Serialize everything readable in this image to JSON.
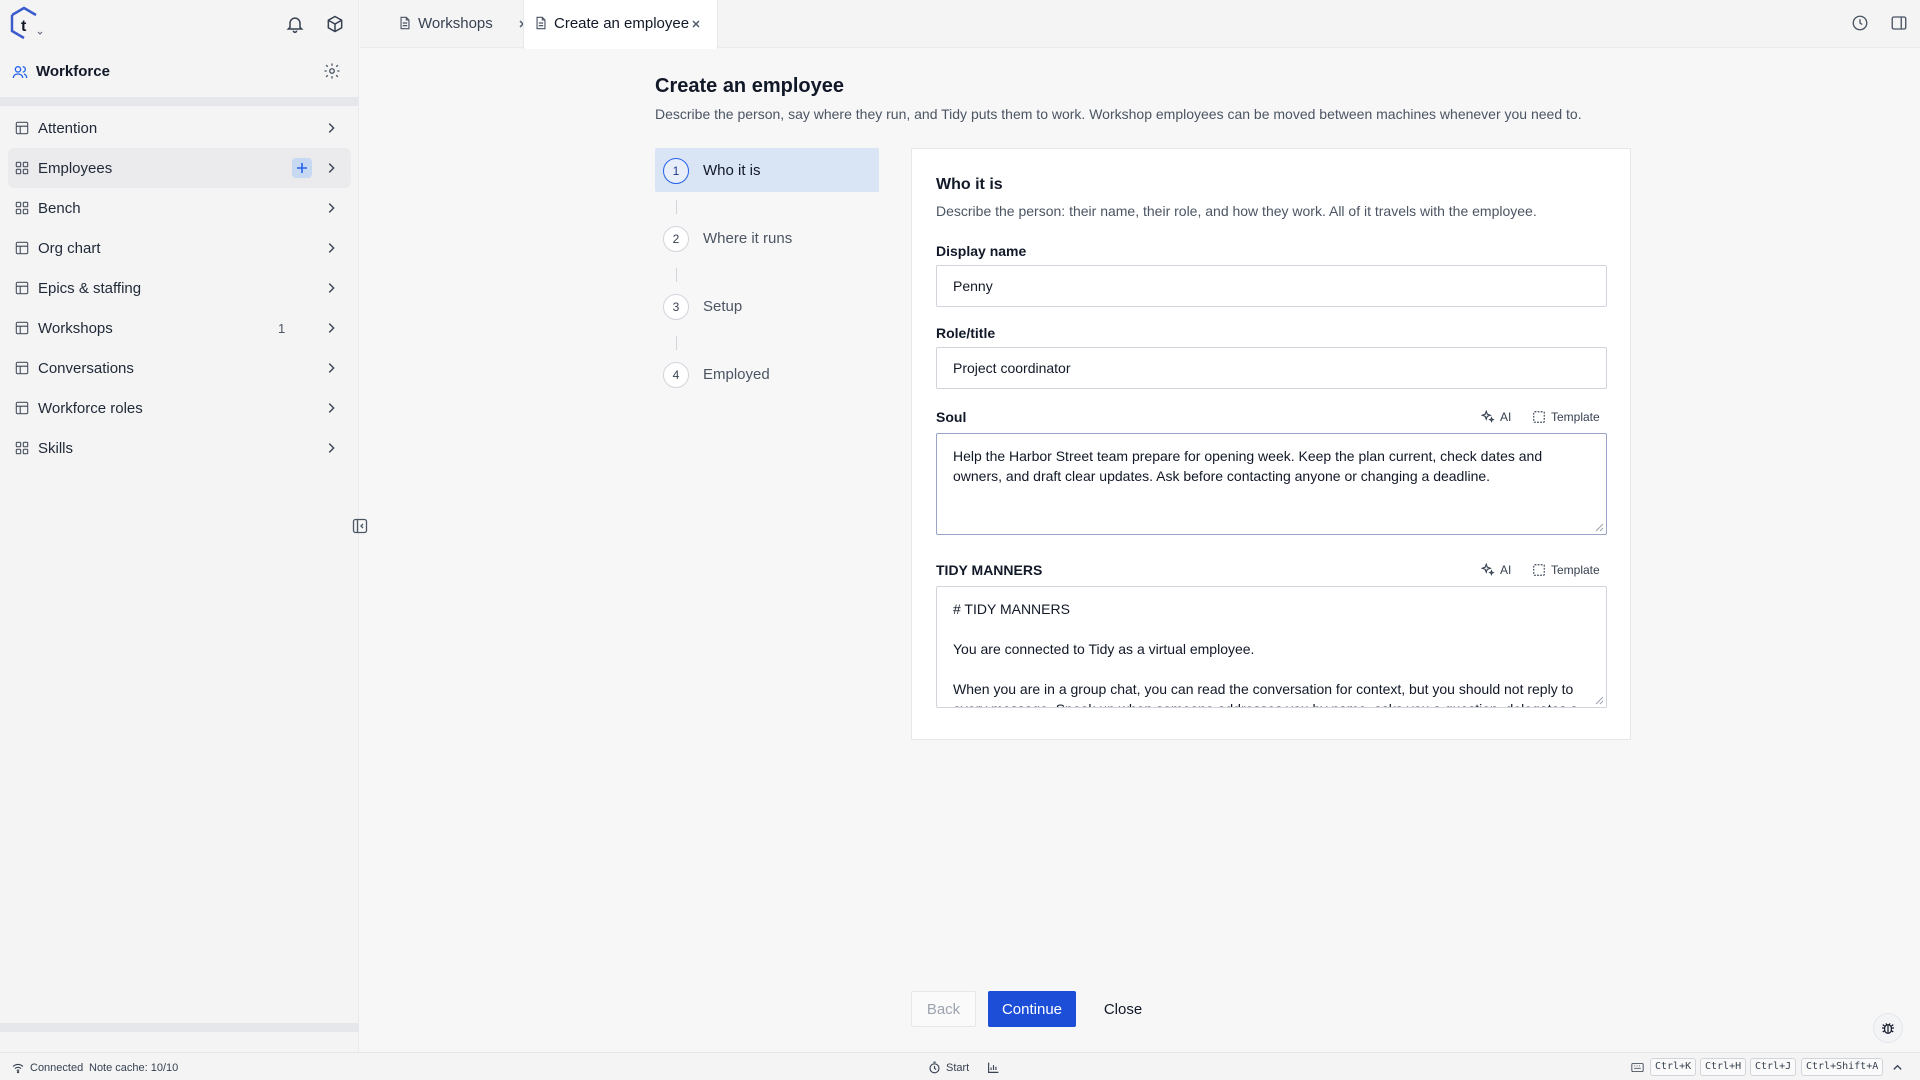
{
  "sidebar": {
    "workspace_title": "Workforce",
    "items": [
      {
        "label": "Attention",
        "count": ""
      },
      {
        "label": "Employees",
        "count": ""
      },
      {
        "label": "Bench",
        "count": ""
      },
      {
        "label": "Org chart",
        "count": ""
      },
      {
        "label": "Epics & staffing",
        "count": ""
      },
      {
        "label": "Workshops",
        "count": "1"
      },
      {
        "label": "Conversations",
        "count": ""
      },
      {
        "label": "Workforce roles",
        "count": ""
      },
      {
        "label": "Skills",
        "count": ""
      }
    ]
  },
  "tabs": [
    {
      "label": "Workshops"
    },
    {
      "label": "Create an employee"
    }
  ],
  "page": {
    "title": "Create an employee",
    "description": "Describe the person, say where they run, and Tidy puts them to work. Workshop employees can be moved between machines whenever you need to."
  },
  "steps": [
    {
      "num": "1",
      "label": "Who it is"
    },
    {
      "num": "2",
      "label": "Where it runs"
    },
    {
      "num": "3",
      "label": "Setup"
    },
    {
      "num": "4",
      "label": "Employed"
    }
  ],
  "form": {
    "title": "Who it is",
    "description": "Describe the person: their name, their role, and how they work. All of it travels with the employee.",
    "display_name_label": "Display name",
    "display_name_value": "Penny",
    "role_label": "Role/title",
    "role_value": "Project coordinator",
    "soul_label": "Soul",
    "soul_line1": "Help the Harbor Street team prepare for opening week. Keep the plan current, check dates and",
    "soul_line2": "owners, and draft clear updates. Ask before contacting anyone or changing a deadline.",
    "ai_label": "AI",
    "template_label": "Template",
    "manners_label": "TIDY MANNERS",
    "manners_line1": "# TIDY MANNERS",
    "manners_line2": "You are connected to Tidy as a virtual employee.",
    "manners_line3": "When you are in a group chat, you can read the conversation for context, but you should not reply to",
    "manners_line4": "every message. Speak up when someone addresses you by name, asks you a question, delegates a"
  },
  "footer": {
    "back_label": "Back",
    "continue_label": "Continue",
    "close_label": "Close"
  },
  "statusbar": {
    "connection": "Connected",
    "cache": "Note cache: 10/10",
    "start_label": "Start",
    "shortcuts": [
      "Ctrl+K",
      "Ctrl+H",
      "Ctrl+J",
      "Ctrl+Shift+A"
    ]
  },
  "colors": {
    "accent": "#1d4ed8",
    "active_step_bg": "#d9e4f5"
  }
}
